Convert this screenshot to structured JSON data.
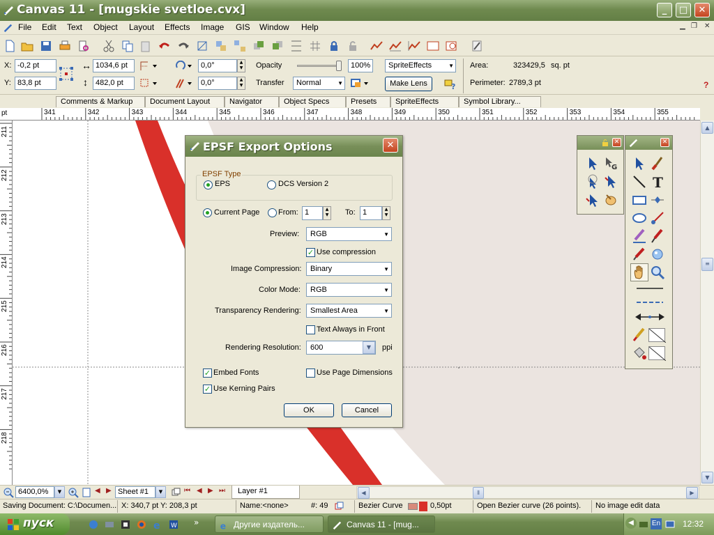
{
  "window": {
    "title": "Canvas 11 - [mugskie svetloe.cvx]",
    "min_label": "_",
    "max_label": "□",
    "close_label": "✕"
  },
  "menu": [
    "File",
    "Edit",
    "Text",
    "Object",
    "Layout",
    "Effects",
    "Image",
    "GIS",
    "Window",
    "Help"
  ],
  "props": {
    "x_label": "X:",
    "x_value": "-0,2 pt",
    "y_label": "Y:",
    "y_value": "83,8 pt",
    "w_value": "1034,6 pt",
    "h_value": "482,0 pt",
    "rot_value": "0,0°",
    "skew_value": "0,0°",
    "opacity_label": "Opacity",
    "opacity_value": "100%",
    "opacity_level": 1.0,
    "transfer_label": "Transfer",
    "transfer_value": "Normal",
    "effect_select": "SpriteEffects",
    "make_lens": "Make Lens",
    "area_label": "Area:",
    "area_value": "323429,5",
    "area_unit": "sq. pt",
    "perimeter_label": "Perimeter:",
    "perimeter_value": "2789,3 pt",
    "help_mark": "?"
  },
  "tabs": [
    "Comments & Markup",
    "Document Layout",
    "Navigator",
    "Object Specs",
    "Presets",
    "SpriteEffects",
    "Symbol Library..."
  ],
  "ruler": {
    "unit": "pt",
    "h_labels": [
      "341",
      "342",
      "343",
      "344",
      "345",
      "346",
      "347",
      "348",
      "349",
      "350",
      "351",
      "352",
      "353",
      "354",
      "355"
    ],
    "v_labels": [
      "211",
      "212",
      "213",
      "214",
      "215",
      "216",
      "217",
      "218"
    ]
  },
  "dialog": {
    "title": "EPSF Export Options",
    "group_label": "EPSF Type",
    "eps_label": "EPS",
    "dcs_label": "DCS Version 2",
    "current_page": "Current Page",
    "from_label": "From:",
    "from_value": "1",
    "to_label": "To:",
    "to_value": "1",
    "preview_label": "Preview:",
    "preview_value": "RGB",
    "use_compression": "Use compression",
    "image_compression_label": "Image Compression:",
    "image_compression_value": "Binary",
    "color_mode_label": "Color Mode:",
    "color_mode_value": "RGB",
    "transparency_label": "Transparency Rendering:",
    "transparency_value": "Smallest Area",
    "text_front": "Text Always in Front",
    "resolution_label": "Rendering Resolution:",
    "resolution_value": "600",
    "resolution_unit": "ppi",
    "embed_fonts": "Embed Fonts",
    "use_page_dims": "Use Page Dimensions",
    "kerning": "Use Kerning Pairs",
    "ok": "OK",
    "cancel": "Cancel",
    "checkmark": "✓"
  },
  "bottom": {
    "zoom": "6400,0%",
    "sheet": "Sheet #1",
    "layer": "Layer #1"
  },
  "status": {
    "saving": "Saving Document: C:\\Documen...",
    "coords": "X: 340,7 pt Y: 208,3 pt",
    "name": "Name:<none>",
    "count": "#: 49",
    "type": "Bezier Curve",
    "stroke": "0,50pt",
    "desc": "Open Bezier curve (26 points).",
    "image": "No image edit data"
  },
  "taskbar": {
    "start": "пуск",
    "task1": "Другие издатель...",
    "task2": "Canvas 11 - [mug...",
    "lang": "En",
    "time": "12:32"
  },
  "colors": {
    "accent_red": "#d9302a",
    "check_green": "#21a121"
  }
}
